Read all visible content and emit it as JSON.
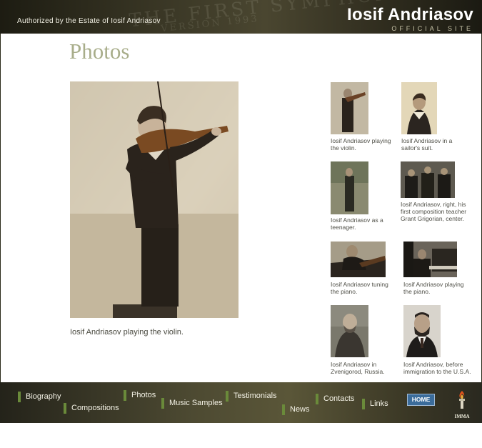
{
  "header": {
    "tagline": "Authorized by the Estate of Iosif Andriasov",
    "brand_name": "Iosif Andriasov",
    "brand_sub": "OFFICIAL SITE"
  },
  "page": {
    "title": "Photos",
    "main_caption": "Iosif Andriasov playing the violin."
  },
  "thumbnails": [
    {
      "caption": "Iosif Andriasov playing the violin."
    },
    {
      "caption": "Iosif Andriasov in a sailor's suit."
    },
    {
      "caption": "Iosif Andriasov as a teenager."
    },
    {
      "caption": "Iosif Andriasov, right, his first composition teacher Grant Grigorian, center."
    },
    {
      "caption": "Iosif Andriasov tuning the piano."
    },
    {
      "caption": "Iosif Andriasov playing the piano."
    },
    {
      "caption": "Iosif Andriasov in Zvenigorod, Russia."
    },
    {
      "caption": "Iosif Andriasov, before immigration to the U.S.A."
    }
  ],
  "nav": {
    "biography": "Biography",
    "compositions": "Compositions",
    "photos": "Photos",
    "music_samples": "Music Samples",
    "testimonials": "Testimonials",
    "news": "News",
    "contacts": "Contacts",
    "links": "Links",
    "home": "HOME"
  },
  "logo": {
    "text": "IMMA"
  }
}
